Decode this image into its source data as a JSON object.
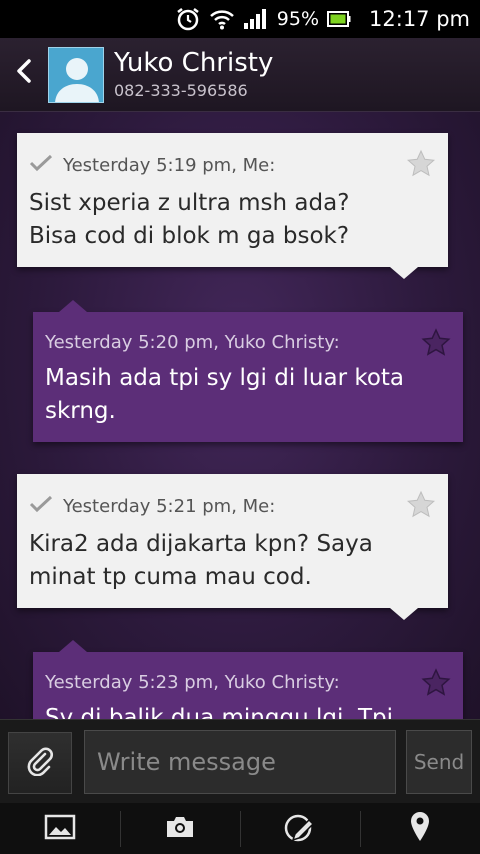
{
  "status_bar": {
    "battery_percent": "95%",
    "time": "12:17 pm"
  },
  "header": {
    "contact_name": "Yuko Christy",
    "contact_phone": "082-333-596586"
  },
  "messages": [
    {
      "direction": "sent",
      "meta": "Yesterday 5:19 pm, Me:",
      "body": "Sist xperia z ultra msh ada? Bisa cod di blok m ga bsok?"
    },
    {
      "direction": "received",
      "meta": "Yesterday 5:20 pm, Yuko Christy:",
      "body": "Masih ada tpi sy lgi di luar kota skrng."
    },
    {
      "direction": "sent",
      "meta": "Yesterday 5:21 pm, Me:",
      "body": "Kira2 ada dijakarta kpn? Saya minat tp cuma mau cod."
    },
    {
      "direction": "received",
      "meta": "Yesterday 5:23 pm, Yuko Christy:",
      "body": "Sy di balik dua minggu lgi. Tpi"
    }
  ],
  "compose": {
    "placeholder": "Write message",
    "send_label": "Send"
  },
  "toolbar": {
    "icons": [
      "gallery-icon",
      "camera-icon",
      "sketch-icon",
      "location-icon"
    ]
  },
  "colors": {
    "sent_bubble": "#f1f1f1",
    "received_bubble": "#5c2e78",
    "background": "#2d1a3d"
  }
}
